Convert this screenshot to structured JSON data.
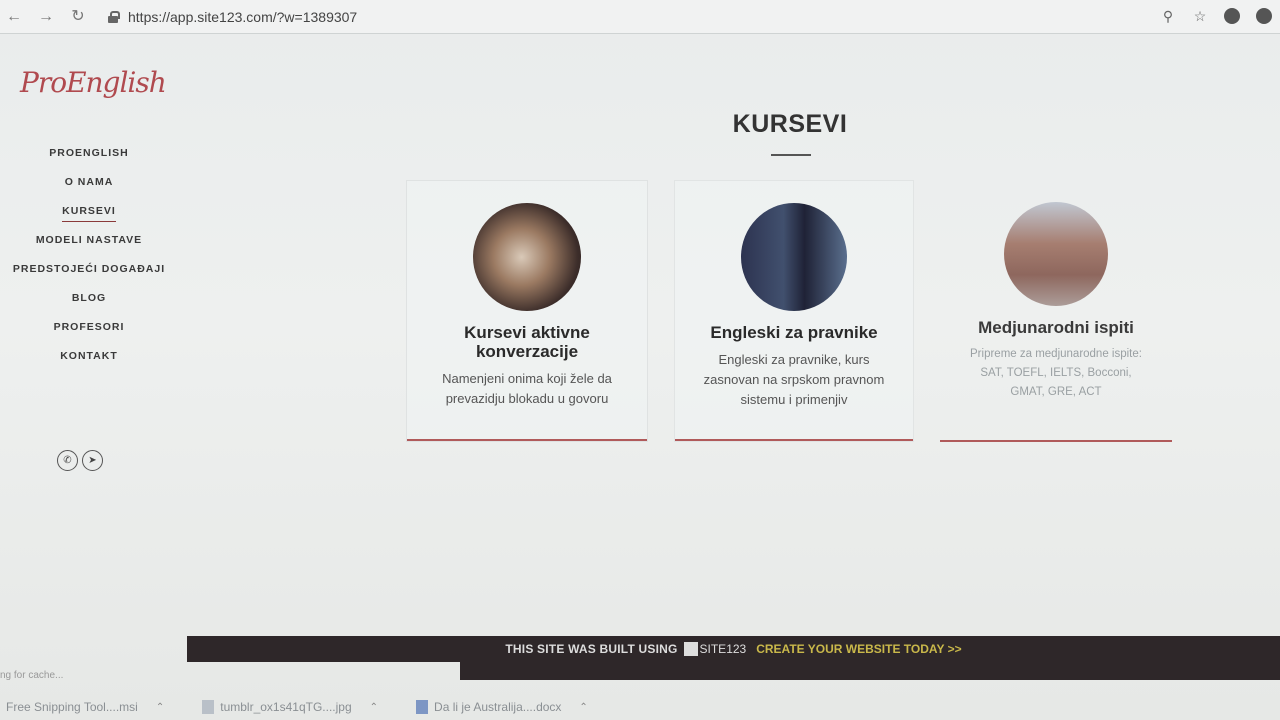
{
  "browser": {
    "url": "https://app.site123.com/?w=1389307",
    "back_icon": "arrow-left-icon",
    "forward_icon": "arrow-right-icon",
    "reload_icon": "reload-icon"
  },
  "sidebar": {
    "logo": "ProEnglish",
    "items": [
      {
        "label": "PROENGLISH"
      },
      {
        "label": "O NAMA"
      },
      {
        "label": "KURSEVI",
        "active": true
      },
      {
        "label": "MODELI NASTAVE"
      },
      {
        "label": "PREDSTOJEĆI DOGAĐAJI"
      },
      {
        "label": "BLOG"
      },
      {
        "label": "PROFESORI"
      },
      {
        "label": "KONTAKT"
      }
    ],
    "social": [
      "phone-icon",
      "location-arrow-icon"
    ]
  },
  "main": {
    "title": "KURSEVI",
    "cards": [
      {
        "title": "Kursevi aktivne konverzacije",
        "description": "Namenjeni onima koji žele da prevazidju blokadu u govoru"
      },
      {
        "title": "Engleski za pravnike",
        "description": "Engleski za pravnike, kurs zasnovan na srpskom pravnom sistemu i primenjiv"
      },
      {
        "title": "Medjunarodni ispiti",
        "description": "Pripreme za medjunarodne ispite: SAT, TOEFL, IELTS, Bocconi, GMAT, GRE, ACT"
      }
    ]
  },
  "footer": {
    "built_text": "THIS SITE WAS BUILT USING",
    "brand": "SITE123",
    "cta": "CREATE YOUR WEBSITE TODAY >>"
  },
  "status": {
    "text": "ng for cache..."
  },
  "downloads": [
    {
      "name": "Free Snipping Tool....msi"
    },
    {
      "name": "tumblr_ox1s41qTG....jpg"
    },
    {
      "name": "Da li je Australija....docx"
    }
  ],
  "colors": {
    "accent": "#b05a5a",
    "logo": "#b04a4f",
    "banner_bg": "#2e2729",
    "cta": "#c9b84a"
  }
}
